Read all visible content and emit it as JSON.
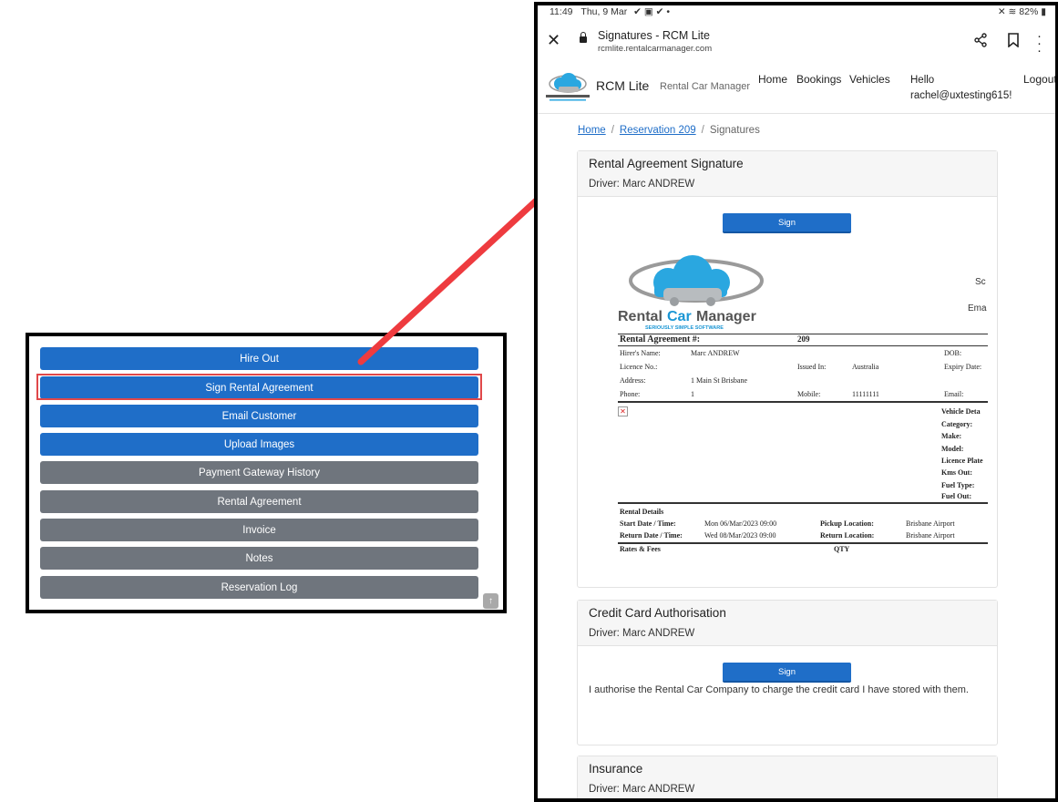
{
  "left_panel": {
    "buttons": [
      {
        "label": "Hire Out",
        "style": "blue"
      },
      {
        "label": "Sign Rental Agreement",
        "style": "blue",
        "highlighted": true
      },
      {
        "label": "Email Customer",
        "style": "blue"
      },
      {
        "label": "Upload Images",
        "style": "blue"
      },
      {
        "label": "Payment Gateway History",
        "style": "grey"
      },
      {
        "label": "Rental Agreement",
        "style": "grey"
      },
      {
        "label": "Invoice",
        "style": "grey"
      },
      {
        "label": "Notes",
        "style": "grey"
      },
      {
        "label": "Reservation Log",
        "style": "grey"
      }
    ],
    "scroll_icon": "arrow-up-icon"
  },
  "colors": {
    "primary": "#1f6ec8",
    "secondary": "#6f757d",
    "highlight": "#e0484a",
    "arrow": "#ee3b3f"
  },
  "status_bar": {
    "time": "11:49",
    "date": "Thu, 9 Mar",
    "battery": "82%"
  },
  "browser": {
    "title": "Signatures - RCM Lite",
    "url": "rcmlite.rentalcarmanager.com"
  },
  "site": {
    "brand": "RCM Lite",
    "brand_sub": "Rental Car Manager",
    "nav": [
      "Home",
      "Bookings",
      "Vehicles"
    ],
    "hello_label": "Hello",
    "user": "rachel@uxtesting615!",
    "logout": "Logout"
  },
  "breadcrumb": {
    "home": "Home",
    "reservation": "Reservation 209",
    "current": "Signatures"
  },
  "cards": {
    "rental": {
      "title": "Rental Agreement Signature",
      "driver": "Driver: Marc ANDREW",
      "sign": "Sign"
    },
    "credit": {
      "title": "Credit Card Authorisation",
      "driver": "Driver: Marc ANDREW",
      "sign": "Sign",
      "consent": "I authorise the Rental Car Company to charge the credit card I have stored with them."
    },
    "insurance": {
      "title": "Insurance",
      "driver": "Driver: Marc ANDREW"
    }
  },
  "agreement": {
    "logo_text_rental": "Rental",
    "logo_text_car": "Car",
    "logo_text_manager": "Manager",
    "logo_tagline": "SERIOUSLY SIMPLE SOFTWARE",
    "side_sc": "Sc",
    "side_ema": "Ema",
    "heading": "Rental Agreement #:",
    "number": "209",
    "hirer_label": "Hirer's Name:",
    "hirer": "Marc ANDREW",
    "dob_label": "DOB:",
    "licence_label": "Licence No.:",
    "issued_label": "Issued In:",
    "issued": "Australia",
    "expiry_label": "Expiry Date:",
    "address_label": "Address:",
    "address": "1 Main St  Brisbane",
    "phone_label": "Phone:",
    "phone": "1",
    "mobile_label": "Mobile:",
    "mobile": "11111111",
    "email_label": "Email:",
    "vehicle_title": "Vehicle Deta",
    "vehicle_fields": [
      "Category:",
      "Make:",
      "Model:",
      "Licence Plate",
      "Kms Out:",
      "Fuel Type:",
      "Fuel Out:"
    ],
    "rental_details": "Rental Details",
    "start_label": "Start Date / Time:",
    "start": "Mon 06/Mar/2023 09:00",
    "return_label": "Return Date / Time:",
    "return": "Wed 08/Mar/2023 09:00",
    "pickup_label": "Pickup Location:",
    "pickup": "Brisbane Airport",
    "return_loc_label": "Return Location:",
    "return_loc": "Brisbane Airport",
    "rates": "Rates & Fees",
    "qty": "QTY"
  }
}
